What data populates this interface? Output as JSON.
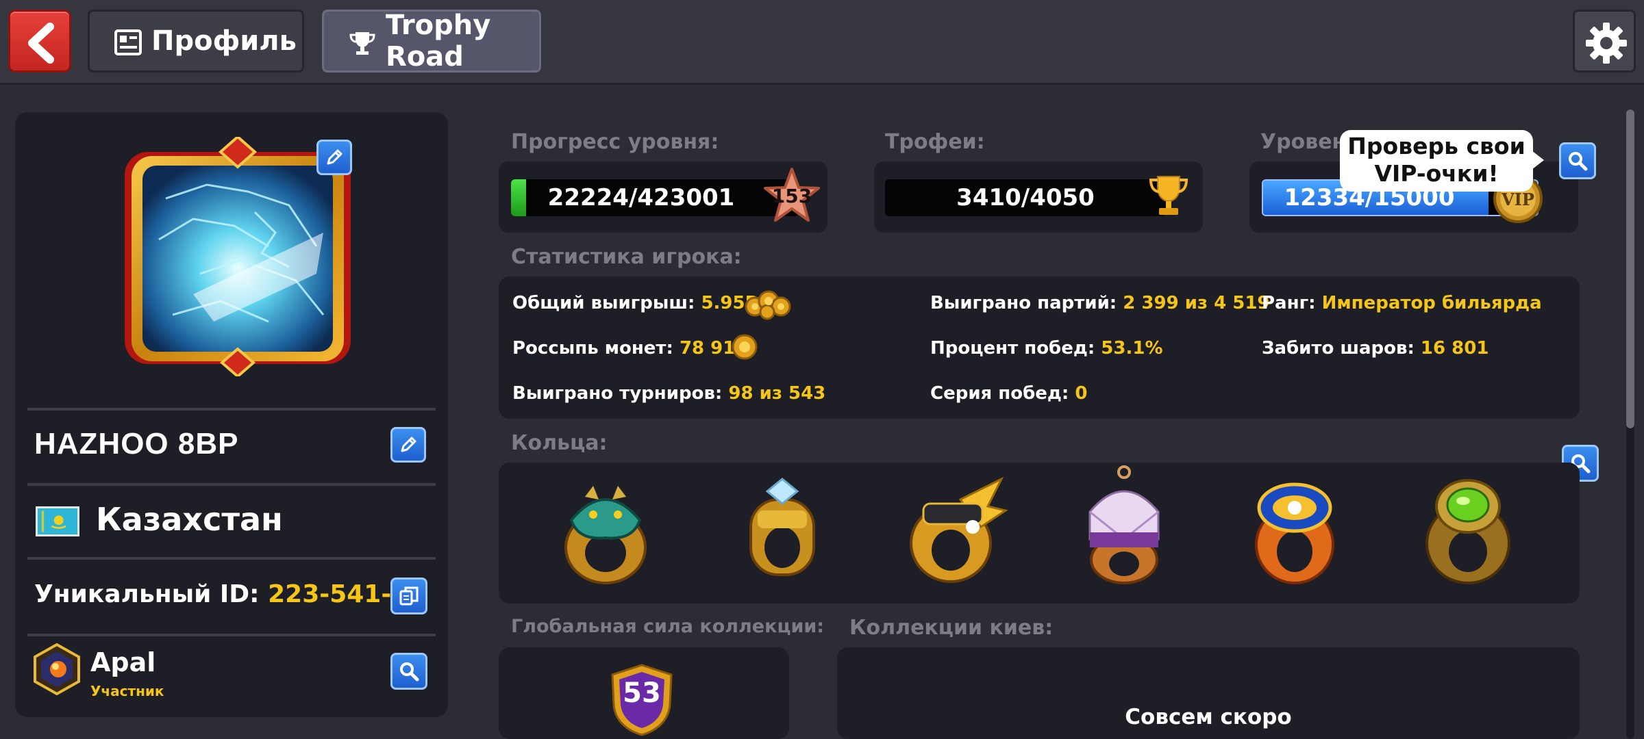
{
  "topbar": {
    "back_icon": "chevron-left-icon",
    "tabs": [
      {
        "label": "Профиль",
        "icon": "profile-card-icon"
      },
      {
        "label": "Trophy Road",
        "icon": "trophy-icon"
      }
    ],
    "settings_icon": "gear-icon"
  },
  "profile": {
    "name": "HAZHOO 8BP",
    "country": "Казахстан",
    "uid_label": "Уникальный ID:",
    "uid_value": "223-541-11",
    "club_name": "Apal",
    "club_role": "Участник"
  },
  "progress": {
    "level_label": "Прогресс уровня:",
    "level_value": "22224/423001",
    "level_fraction": 0.0525,
    "level_number": "153",
    "trophies_label": "Трофеи:",
    "trophies_value": "3410/4050",
    "vip_label": "Уровень",
    "vip_value": "12334/15000",
    "vip_fraction": 0.822,
    "vip_badge": "VIP",
    "tooltip": "Проверь свои VIP-очки!"
  },
  "stats": {
    "title": "Статистика игрока:",
    "items": [
      {
        "label": "Общий выигрыш:",
        "value": "5.95B"
      },
      {
        "label": "Выиграно партий:",
        "value": "2 399 из 4 519"
      },
      {
        "label": "Ранг:",
        "value": "Император бильярда"
      },
      {
        "label": "Россыпь монет:",
        "value": "78 913"
      },
      {
        "label": "Процент побед:",
        "value": "53.1%"
      },
      {
        "label": "Забито шаров:",
        "value": "16 801"
      },
      {
        "label": "Выиграно турниров:",
        "value": "98 из 543"
      },
      {
        "label": "Серия побед:",
        "value": "0"
      }
    ]
  },
  "rings": {
    "title": "Кольца:",
    "items": [
      "dragon-ring",
      "heist-ring",
      "gold-wings-ring",
      "crystal-ring",
      "legend-blue-ring",
      "legend-green-ring"
    ]
  },
  "collection": {
    "power_title": "Глобальная сила коллекции:",
    "power_value": "53",
    "cues_title": "Коллекции киев:",
    "cues_status": "Совсем скоро"
  },
  "colors": {
    "accent_yellow": "#f5c518",
    "button_blue": "#2d7be0",
    "back_red": "#d8332c",
    "panel": "#1e1f26",
    "background": "#2b2c34"
  }
}
